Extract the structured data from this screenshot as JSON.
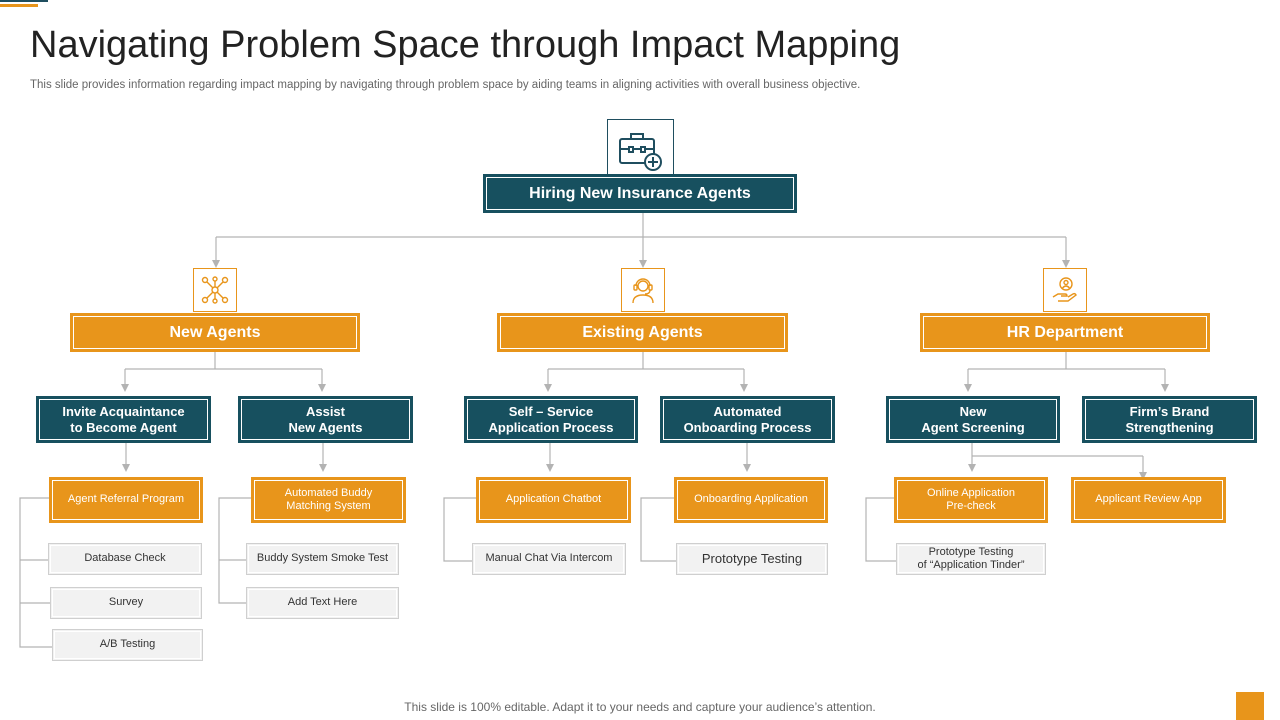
{
  "slide": {
    "title": "Navigating Problem Space through Impact Mapping",
    "subtitle": "This slide provides information regarding impact mapping by navigating through problem space by aiding teams in aligning activities with overall business objective.",
    "footer": "This slide is 100% editable. Adapt it to your needs and capture your audience’s attention."
  },
  "colors": {
    "accent": "#e8951b",
    "dark": "#17505f",
    "gray": "#f2f2f2"
  },
  "root": {
    "label": "Hiring New Insurance Agents",
    "icon": "briefcase-add-icon"
  },
  "branches": [
    {
      "label": "New Agents",
      "icon": "network-nodes-icon",
      "children": [
        {
          "label": "Invite Acquaintance\nto Become Agent",
          "deliverable": "Agent Referral Program",
          "items": [
            "Database Check",
            "Survey",
            "A/B Testing"
          ]
        },
        {
          "label": "Assist\nNew Agents",
          "deliverable": "Automated Buddy\nMatching System",
          "items": [
            "Buddy System Smoke Test",
            "Add Text Here"
          ]
        }
      ]
    },
    {
      "label": "Existing Agents",
      "icon": "headset-agent-icon",
      "children": [
        {
          "label": "Self – Service\nApplication Process",
          "deliverable": "Application Chatbot",
          "items": [
            "Manual Chat Via Intercom"
          ]
        },
        {
          "label": "Automated\nOnboarding Process",
          "deliverable": "Onboarding Application",
          "items": [
            "Prototype Testing"
          ]
        }
      ]
    },
    {
      "label": "HR Department",
      "icon": "hand-user-icon",
      "children": [
        {
          "label": "New\nAgent Screening",
          "deliverable": "Online Application\nPre-check",
          "deliverable_2": "Applicant Review App",
          "items": [
            "Prototype Testing\nof “Application Tinder”"
          ]
        },
        {
          "label": "Firm’s Brand\nStrengthening"
        }
      ]
    }
  ]
}
